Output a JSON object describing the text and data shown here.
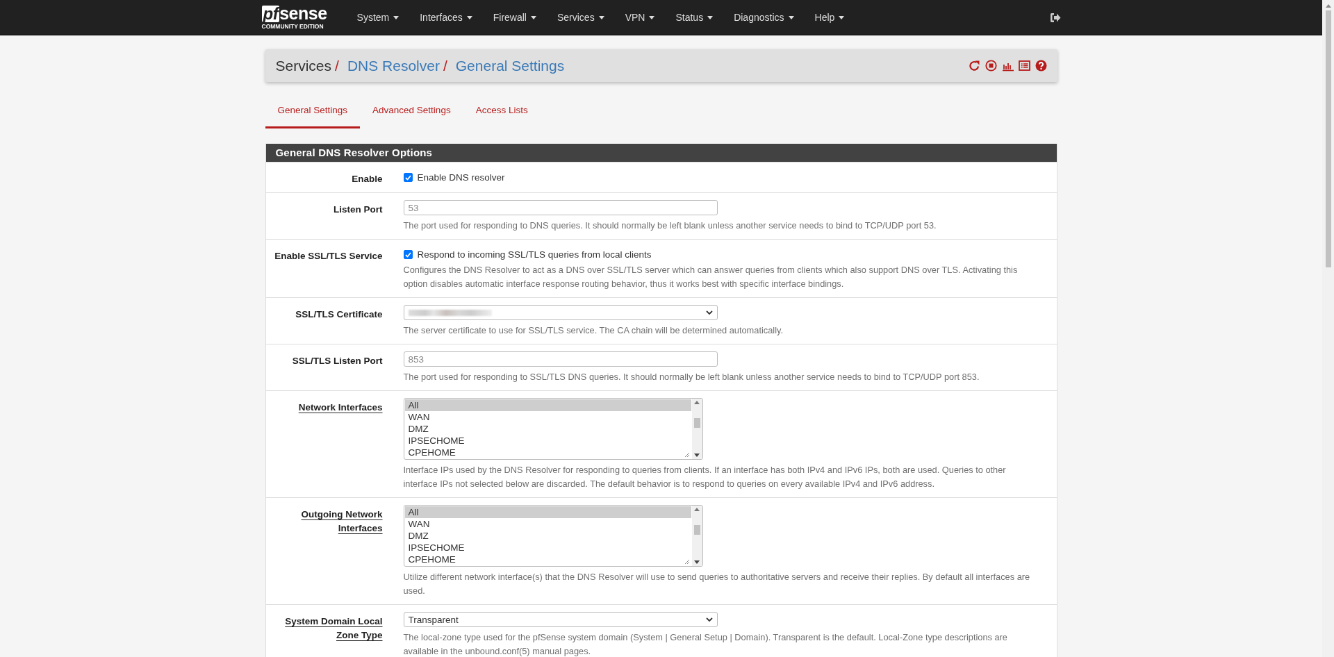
{
  "navbar": {
    "logo": {
      "prefix": "pf",
      "name": "sense",
      "edition": "COMMUNITY EDITION"
    },
    "menus": [
      {
        "label": "System"
      },
      {
        "label": "Interfaces"
      },
      {
        "label": "Firewall"
      },
      {
        "label": "Services"
      },
      {
        "label": "VPN"
      },
      {
        "label": "Status"
      },
      {
        "label": "Diagnostics"
      },
      {
        "label": "Help"
      }
    ]
  },
  "breadcrumb": {
    "items": [
      {
        "label": "Services",
        "link": false,
        "separator": "/"
      },
      {
        "label": "DNS Resolver",
        "link": true,
        "separator": "/"
      },
      {
        "label": "General Settings",
        "link": true
      }
    ]
  },
  "tabs": [
    {
      "label": "General Settings",
      "selected": true
    },
    {
      "label": "Advanced Settings",
      "selected": false
    },
    {
      "label": "Access Lists",
      "selected": false
    }
  ],
  "panel": {
    "title": "General DNS Resolver Options",
    "rows": [
      {
        "kind": "checkbox",
        "label": "Enable",
        "label_link": false,
        "checked": true,
        "text": "Enable DNS resolver"
      },
      {
        "kind": "input",
        "label": "Listen Port",
        "label_link": false,
        "placeholder": "53",
        "help": "The port used for responding to DNS queries. It should normally be left blank unless another service needs to bind to TCP/UDP port 53."
      },
      {
        "kind": "checkbox",
        "label": "Enable SSL/TLS Service",
        "label_link": false,
        "checked": true,
        "text": "Respond to incoming SSL/TLS queries from local clients",
        "help": "Configures the DNS Resolver to act as a DNS over SSL/TLS server which can answer queries from clients which also support DNS over TLS. Activating this option disables automatic interface response routing behavior, thus it works best with specific interface bindings."
      },
      {
        "kind": "select",
        "label": "SSL/TLS Certificate",
        "label_link": false,
        "redacted": true,
        "help": "The server certificate to use for SSL/TLS service. The CA chain will be determined automatically."
      },
      {
        "kind": "input",
        "label": "SSL/TLS Listen Port",
        "label_link": false,
        "placeholder": "853",
        "help": "The port used for responding to SSL/TLS DNS queries. It should normally be left blank unless another service needs to bind to TCP/UDP port 853."
      },
      {
        "kind": "listbox",
        "label": "Network Interfaces",
        "label_link": true,
        "options": [
          {
            "label": "All",
            "selected": true
          },
          {
            "label": "WAN",
            "selected": false
          },
          {
            "label": "DMZ",
            "selected": false
          },
          {
            "label": "IPSECHOME",
            "selected": false
          },
          {
            "label": "CPEHOME",
            "selected": false
          }
        ],
        "help": "Interface IPs used by the DNS Resolver for responding to queries from clients. If an interface has both IPv4 and IPv6 IPs, both are used. Queries to other interface IPs not selected below are discarded. The default behavior is to respond to queries on every available IPv4 and IPv6 address."
      },
      {
        "kind": "listbox",
        "label": "Outgoing Network Interfaces",
        "label_link": true,
        "options": [
          {
            "label": "All",
            "selected": true
          },
          {
            "label": "WAN",
            "selected": false
          },
          {
            "label": "DMZ",
            "selected": false
          },
          {
            "label": "IPSECHOME",
            "selected": false
          },
          {
            "label": "CPEHOME",
            "selected": false
          }
        ],
        "help": "Utilize different network interface(s) that the DNS Resolver will use to send queries to authoritative servers and receive their replies. By default all interfaces are used."
      },
      {
        "kind": "select",
        "label": "System Domain Local Zone Type",
        "label_link": true,
        "value": "Transparent",
        "help": "The local-zone type used for the pfSense system domain (System | General Setup | Domain). Transparent is the default. Local-Zone type descriptions are available in the unbound.conf(5) manual pages."
      }
    ]
  }
}
